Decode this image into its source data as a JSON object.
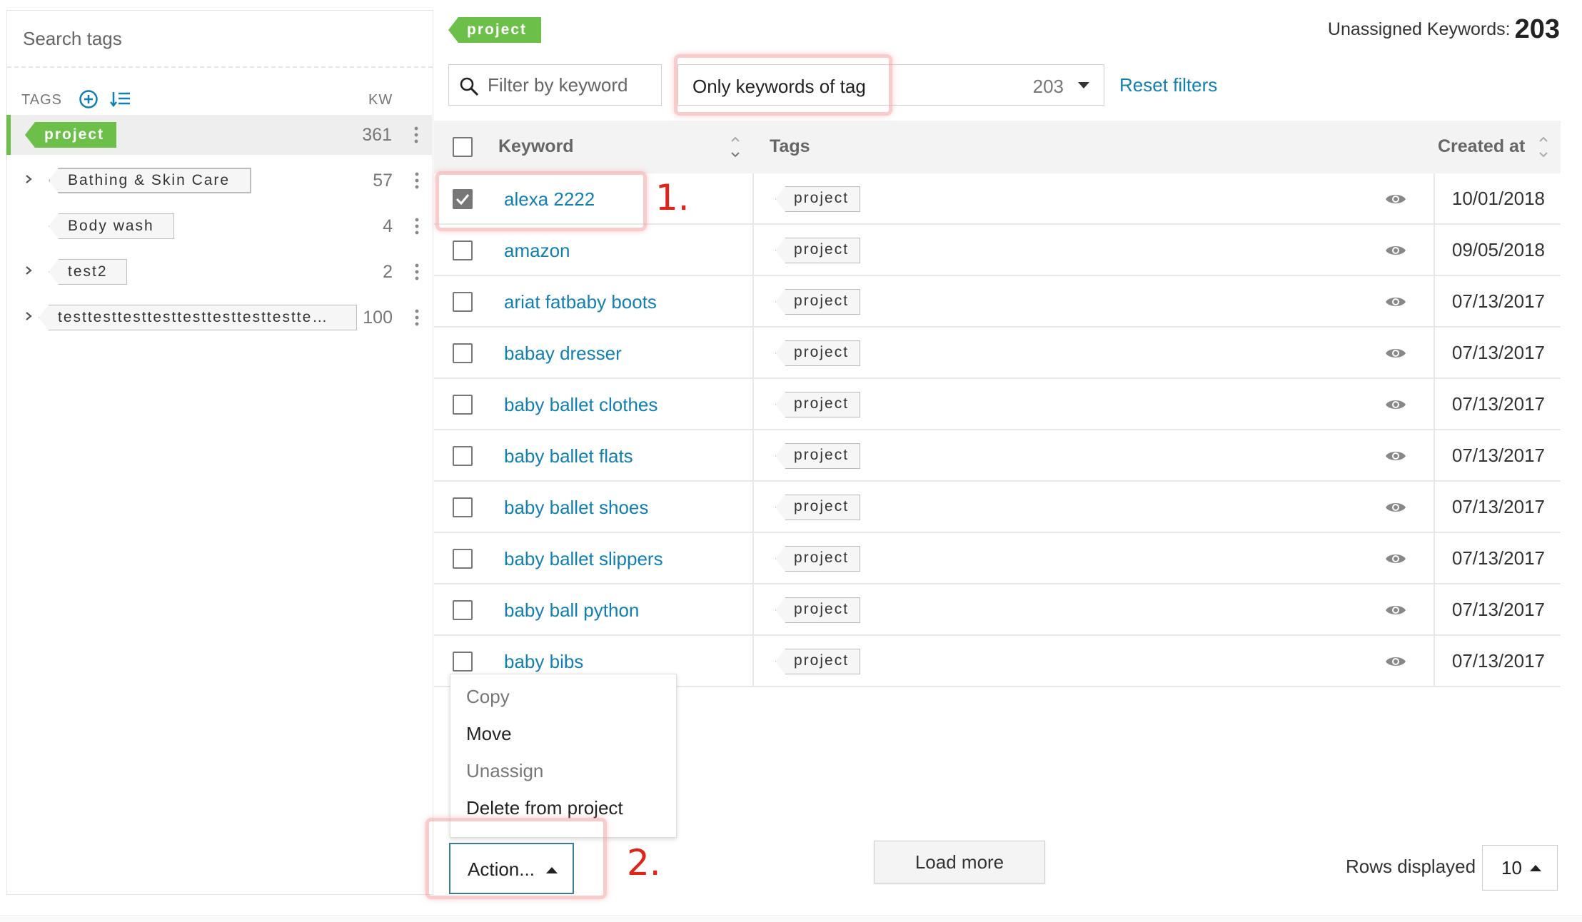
{
  "sidebar": {
    "search_placeholder": "Search tags",
    "header": {
      "tags_label": "TAGS",
      "kw_label": "KW",
      "add_icon": "plus-circle-icon",
      "sort_icon": "sort-list-icon"
    },
    "tags": [
      {
        "name": "project",
        "count": "361",
        "active": true,
        "expandable": false,
        "color": "#6cc04a"
      },
      {
        "name": "Bathing & Skin Care",
        "count": "57",
        "expandable": true
      },
      {
        "name": "Body wash",
        "count": "4",
        "expandable": false
      },
      {
        "name": "test2",
        "count": "2",
        "expandable": true
      },
      {
        "name": "testtesttesttesttesttesttesttestte…",
        "count": "100",
        "expandable": true
      }
    ]
  },
  "main": {
    "current_tag": "project",
    "unassigned_label": "Unassigned Keywords:",
    "unassigned_count": "203",
    "filter": {
      "keyword_placeholder": "Filter by keyword",
      "tag_select_label": "Only keywords of tag",
      "tag_select_count": "203",
      "reset_label": "Reset filters"
    },
    "table": {
      "columns": {
        "keyword": "Keyword",
        "tags": "Tags",
        "created": "Created at"
      },
      "rows": [
        {
          "keyword": "alexa 2222",
          "tag": "project",
          "created": "10/01/2018",
          "checked": true
        },
        {
          "keyword": "amazon",
          "tag": "project",
          "created": "09/05/2018",
          "checked": false
        },
        {
          "keyword": "ariat fatbaby boots",
          "tag": "project",
          "created": "07/13/2017",
          "checked": false
        },
        {
          "keyword": "babay dresser",
          "tag": "project",
          "created": "07/13/2017",
          "checked": false
        },
        {
          "keyword": "baby ballet clothes",
          "tag": "project",
          "created": "07/13/2017",
          "checked": false
        },
        {
          "keyword": "baby ballet flats",
          "tag": "project",
          "created": "07/13/2017",
          "checked": false
        },
        {
          "keyword": "baby ballet shoes",
          "tag": "project",
          "created": "07/13/2017",
          "checked": false
        },
        {
          "keyword": "baby ballet slippers",
          "tag": "project",
          "created": "07/13/2017",
          "checked": false
        },
        {
          "keyword": "baby ball python",
          "tag": "project",
          "created": "07/13/2017",
          "checked": false
        },
        {
          "keyword": "baby bibs",
          "tag": "project",
          "created": "07/13/2017",
          "checked": false
        }
      ]
    },
    "action_menu": {
      "items": [
        {
          "label": "Copy",
          "enabled": false
        },
        {
          "label": "Move",
          "enabled": true
        },
        {
          "label": "Unassign",
          "enabled": false
        },
        {
          "label": "Delete from project",
          "enabled": true
        }
      ]
    },
    "action_button_label": "Action...",
    "load_more_label": "Load more",
    "rows_displayed_label": "Rows displayed",
    "rows_displayed_value": "10"
  },
  "annotations": {
    "step1": "1.",
    "step2": "2."
  },
  "colors": {
    "accent_green": "#6cc04a",
    "link_blue": "#127fb3",
    "annotation_red": "#e2231a"
  }
}
